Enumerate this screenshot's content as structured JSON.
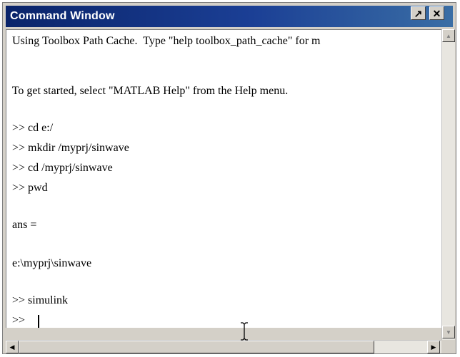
{
  "window": {
    "title": "Command Window",
    "undock_glyph": "↗",
    "close_glyph": "✕"
  },
  "console": {
    "lines": [
      "  Using Toolbox Path Cache.  Type \"help toolbox_path_cache\" for m",
      "  To get started, select \"MATLAB Help\" from the Help menu.",
      ">> cd e:/",
      ">> mkdir /myprj/sinwave",
      ">> cd /myprj/sinwave",
      ">> pwd",
      "ans =",
      "e:\\myprj\\sinwave",
      ">> simulink",
      ">> "
    ]
  },
  "scrollbars": {
    "up_glyph": "▲",
    "down_glyph": "▼",
    "left_glyph": "◀",
    "right_glyph": "▶"
  },
  "icons": {
    "cursor": "text-cursor",
    "pointer": "ibeam-pointer-icon"
  }
}
